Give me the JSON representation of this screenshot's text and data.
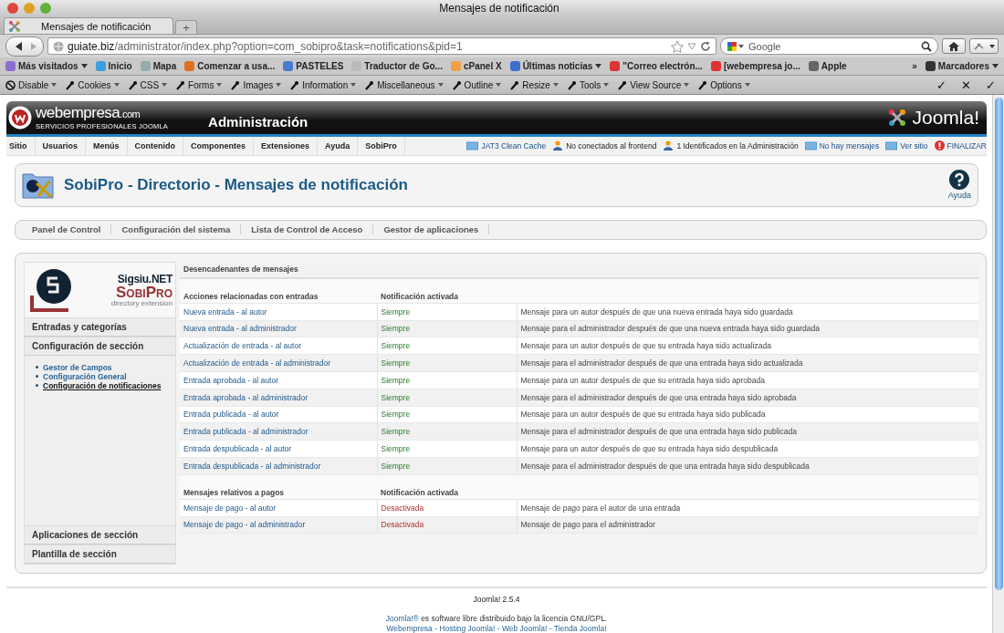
{
  "browser": {
    "window_title": "Mensajes de notificación",
    "tabs": [
      {
        "label": "Mensajes de notificación",
        "selected": true
      }
    ],
    "new_tab": "+",
    "url": {
      "host": "guiate.biz",
      "path": "/administrator/index.php?option=com_sobipro&task=notifications&pid=1"
    },
    "search": {
      "placeholder": "Google"
    },
    "bookmarks": [
      {
        "label": "Más visitados",
        "dropdown": true
      },
      {
        "label": "Inicio",
        "dropdown": false
      },
      {
        "label": "Mapa",
        "dropdown": false
      },
      {
        "label": "Comenzar a usa...",
        "dropdown": false
      },
      {
        "label": "PASTELES",
        "dropdown": false
      },
      {
        "label": "Traductor de Go...",
        "dropdown": false
      },
      {
        "label": "cPanel X",
        "dropdown": false
      },
      {
        "label": "Últimas noticias",
        "dropdown": true
      },
      {
        "label": "\"Correo electrón...",
        "dropdown": false
      },
      {
        "label": "[webempresa jo...",
        "dropdown": false
      },
      {
        "label": "Apple",
        "dropdown": false
      }
    ],
    "bookmarks_more": "»",
    "bookmarks_menu": {
      "label": "Marcadores",
      "dropdown": true
    },
    "dev_tools": [
      "Disable",
      "Cookies",
      "CSS",
      "Forms",
      "Images",
      "Information",
      "Miscellaneous",
      "Outline",
      "Resize",
      "Tools",
      "View Source",
      "Options"
    ],
    "dev_status": [
      "✓",
      "✕",
      "✓"
    ]
  },
  "admin": {
    "brand": "webempresa",
    "brand_suffix": ".com",
    "tagline": "SERVICIOS PROFESIONALES JOOMLA",
    "title": "Administración",
    "logo": "Joomla!",
    "menu": [
      "Sitio",
      "Usuarios",
      "Menús",
      "Contenido",
      "Componentes",
      "Extensiones",
      "Ayuda",
      "SobiPro"
    ],
    "status": [
      {
        "label": "JAT3 Clean Cache",
        "kind": "link"
      },
      {
        "label": "No conectados al frontend",
        "kind": "text"
      },
      {
        "label": "1 Identificados en la Administración",
        "kind": "text"
      },
      {
        "label": "No hay mensajes",
        "kind": "link"
      },
      {
        "label": "Ver sitio",
        "kind": "link"
      },
      {
        "label": "FINALIZAR",
        "kind": "logout"
      }
    ]
  },
  "page_title": "SobiPro - Directorio - Mensajes de notificación",
  "help": "Ayuda",
  "submenu": [
    "Panel de Control",
    "Configuración del sistema",
    "Lista de Control de Acceso",
    "Gestor de aplicaciones"
  ],
  "sidebar": {
    "logo_top": "Sigsiu.NET",
    "logo_name": "SobiPro",
    "logo_sub": "directory extension",
    "sections_top": [
      "Entradas y categorías",
      "Configuración de sección"
    ],
    "links": [
      {
        "label": "Gestor de Campos",
        "selected": false
      },
      {
        "label": "Configuración General",
        "selected": false
      },
      {
        "label": "Configuración de notificaciones",
        "selected": true
      }
    ],
    "sections_bottom": [
      "Aplicaciones de sección",
      "Plantilla de sección"
    ]
  },
  "table": {
    "caption": "Desencadenantes de mensajes",
    "groups": [
      {
        "columns": [
          "Acciones relacionadas con entradas",
          "Notificación activada"
        ],
        "rows": [
          {
            "action": "Nueva entrada - al autor",
            "status": "Siempre",
            "enabled": true,
            "description": "Mensaje para un autor después de que una nueva entrada haya sido guardada"
          },
          {
            "action": "Nueva entrada - al administrador",
            "status": "Siempre",
            "enabled": true,
            "description": "Mensaje para el administrador después de que una nueva entrada haya sido guardada"
          },
          {
            "action": "Actualización de entrada - al autor",
            "status": "Siempre",
            "enabled": true,
            "description": "Mensaje para un autor después de que su entrada haya sido actualizada"
          },
          {
            "action": "Actualización de entrada - al administrador",
            "status": "Siempre",
            "enabled": true,
            "description": "Mensaje para el administrador después de que una entrada haya sido actualizada"
          },
          {
            "action": "Entrada aprobada - al autor",
            "status": "Siempre",
            "enabled": true,
            "description": "Mensaje para un autor después de que su entrada haya sido aprobada"
          },
          {
            "action": "Entrada aprobada - al administrador",
            "status": "Siempre",
            "enabled": true,
            "description": "Mensaje para el administrador después de que una entrada haya sido aprobada"
          },
          {
            "action": "Entrada publicada - al autor",
            "status": "Siempre",
            "enabled": true,
            "description": "Mensaje para un autor después de que su entrada haya sido publicada"
          },
          {
            "action": "Entrada publicada - al administrador",
            "status": "Siempre",
            "enabled": true,
            "description": "Mensaje para el administrador después de que una entrada haya sido publicada"
          },
          {
            "action": "Entrada despublicada - al autor",
            "status": "Siempre",
            "enabled": true,
            "description": "Mensaje para un autor después de que su entrada haya sido despublicada"
          },
          {
            "action": "Entrada despublicada - al administrador",
            "status": "Siempre",
            "enabled": true,
            "description": "Mensaje para el administrador después de que una entrada haya sido despublicada"
          }
        ]
      },
      {
        "columns": [
          "Mensajes relativos a pagos",
          "Notificación activada"
        ],
        "rows": [
          {
            "action": "Mensaje de pago - al autor",
            "status": "Desactivada",
            "enabled": false,
            "description": "Mensaje de pago para el autor de una entrada"
          },
          {
            "action": "Mensaje de pago - al administrador",
            "status": "Desactivada",
            "enabled": false,
            "description": "Mensaje de pago para el administrador"
          }
        ]
      }
    ]
  },
  "footer": {
    "version": "Joomla! 2.5.4",
    "license_link": "Joomla!®",
    "license_text": "es software libre distribuido bajo la licencia GNU/GPL.",
    "links": "Webempresa - Hosting Joomla! - Web Joomla! - Tienda Joomla!"
  }
}
